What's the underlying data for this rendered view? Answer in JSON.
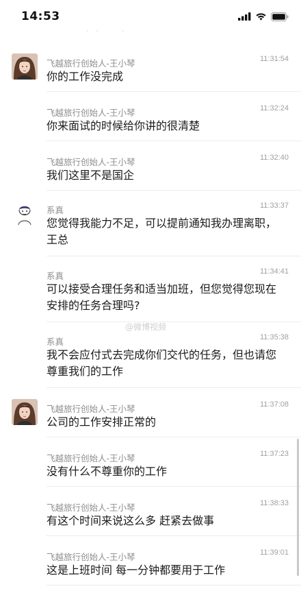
{
  "status_bar": {
    "time": "14:53",
    "icons": [
      "signal-icon",
      "wifi-icon",
      "battery-icon"
    ]
  },
  "messages": [
    {
      "sender": "飞越旅行创始人-王小琴",
      "time": "11:31:54",
      "text": "你的工作没完成",
      "avatar": "woman-avatar"
    },
    {
      "sender": "飞越旅行创始人-王小琴",
      "time": "11:32:24",
      "text": "你来面试的时候给你讲的很清楚"
    },
    {
      "sender": "飞越旅行创始人-王小琴",
      "time": "11:32:40",
      "text": "我们这里不是国企"
    },
    {
      "sender": "系真",
      "time": "11:33:37",
      "text": "您觉得我能力不足，可以提前通知我办理离职，王总",
      "avatar": "cartoon-avatar"
    },
    {
      "sender": "系真",
      "time": "11:34:41",
      "text": "可以接受合理任务和适当加班，但您觉得您现在安排的任务合理吗?"
    },
    {
      "sender": "系真",
      "time": "11:35:38",
      "text": "我不会应付式去完成你们交代的任务，但也请您尊重我们的工作"
    },
    {
      "sender": "飞越旅行创始人-王小琴",
      "time": "11:37:08",
      "text": "公司的工作安排正常的",
      "avatar": "woman-avatar"
    },
    {
      "sender": "飞越旅行创始人-王小琴",
      "time": "11:37:23",
      "text": "没有什么不尊重你的工作"
    },
    {
      "sender": "飞越旅行创始人-王小琴",
      "time": "11:38:33",
      "text": "有这个时间来说这么多 赶紧去做事"
    },
    {
      "sender": "飞越旅行创始人-王小琴",
      "time": "11:39:01",
      "text": "这是上班时间 每一分钟都要用于工作"
    }
  ],
  "watermark": "@微博视频"
}
